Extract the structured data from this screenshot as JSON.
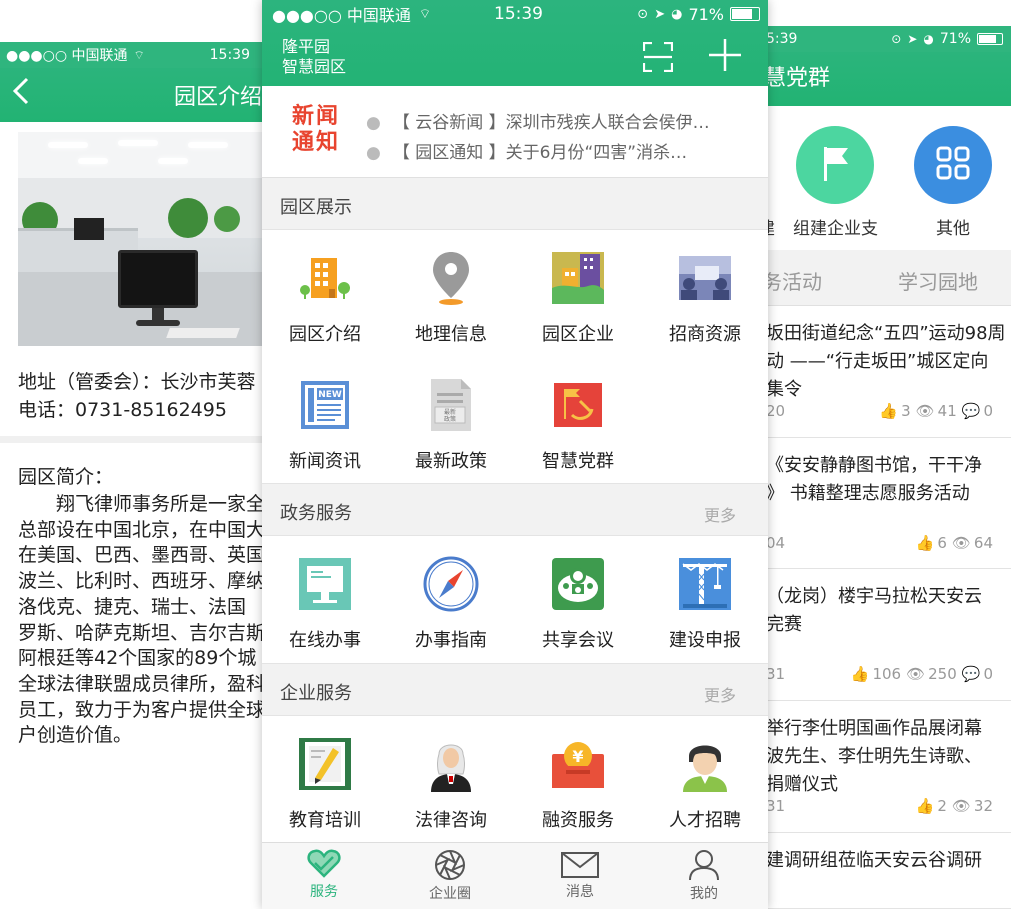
{
  "left": {
    "status": {
      "carrier": "●●●○○ 中国联通",
      "time": "15:39"
    },
    "title": "园区介绍",
    "address": "地址（管委会）：长沙市芙蓉",
    "phone": "电话：0731-85162495",
    "intro_title": "园区简介：",
    "intro_lines": [
      "　　翔飞律师事务所是一家全",
      "总部设在中国北京，在中国大",
      "在美国、巴西、墨西哥、英国",
      "波兰、比利时、西班牙、摩纳",
      "洛伐克、捷克、瑞士、法国",
      "罗斯、哈萨克斯坦、吉尔吉斯",
      "阿根廷等42个国家的89个城",
      "全球法律联盟成员律所，盈科",
      "员工，致力于为客户提供全球",
      "户创造价值。"
    ]
  },
  "center": {
    "status": {
      "carrier": "●●●○○ 中国联通",
      "time": "15:39",
      "battery": "71%"
    },
    "park_name": [
      "隆平园",
      "智慧园区"
    ],
    "news_logo": [
      "新闻",
      "通知"
    ],
    "news": [
      {
        "text": "【 云谷新闻 】深圳市残疾人联合会侯伊…"
      },
      {
        "text": "【 园区通知 】关于6月份“四害”消杀…"
      }
    ],
    "sections": [
      {
        "title": "园区展示",
        "more": "",
        "items": [
          {
            "label": "园区介绍",
            "icon": "building-icon"
          },
          {
            "label": "地理信息",
            "icon": "location-pin-icon"
          },
          {
            "label": "园区企业",
            "icon": "city-icon"
          },
          {
            "label": "招商资源",
            "icon": "office-icon"
          },
          {
            "label": "新闻资讯",
            "icon": "newspaper-icon"
          },
          {
            "label": "最新政策",
            "icon": "policy-doc-icon"
          },
          {
            "label": "智慧党群",
            "icon": "party-flag-icon"
          }
        ]
      },
      {
        "title": "政务服务",
        "more": "更多",
        "items": [
          {
            "label": "在线办事",
            "icon": "computer-icon"
          },
          {
            "label": "办事指南",
            "icon": "compass-icon"
          },
          {
            "label": "共享会议",
            "icon": "meeting-icon"
          },
          {
            "label": "建设申报",
            "icon": "crane-icon"
          }
        ]
      },
      {
        "title": "企业服务",
        "more": "更多",
        "items": [
          {
            "label": "教育培训",
            "icon": "pencil-board-icon"
          },
          {
            "label": "法律咨询",
            "icon": "judge-icon"
          },
          {
            "label": "融资服务",
            "icon": "money-wallet-icon"
          },
          {
            "label": "人才招聘",
            "icon": "person-icon"
          }
        ]
      }
    ],
    "tabbar": [
      {
        "label": "服务",
        "icon": "heart-icon",
        "active": true
      },
      {
        "label": "企业圈",
        "icon": "aperture-icon",
        "active": false
      },
      {
        "label": "消息",
        "icon": "mail-icon",
        "active": false
      },
      {
        "label": "我的",
        "icon": "user-icon",
        "active": false
      }
    ]
  },
  "right": {
    "status": {
      "time": "5:39",
      "battery": "71%"
    },
    "title": "慧党群",
    "circles": [
      {
        "label": "组建企业支",
        "color": "#4cd6a0",
        "icon": "flag-icon"
      },
      {
        "label": "其他",
        "color": "#3b8ee0",
        "icon": "grid-icon"
      }
    ],
    "partial_left_label": "建",
    "tabs": [
      "务活动",
      "学习园地"
    ],
    "news": [
      {
        "lines": [
          "坂田街道纪念“五四”运动98周",
          "动 ——“行走坂田”城区定向",
          "集令"
        ],
        "date": "20",
        "likes": "3",
        "views": "41",
        "comments": "0"
      },
      {
        "lines": [
          "《安安静静图书馆，干干净",
          "》 书籍整理志愿服务活动"
        ],
        "date": "04",
        "likes": "6",
        "views": "64",
        "comments": ""
      },
      {
        "lines": [
          "（龙岗）楼宇马拉松天安云",
          "完赛"
        ],
        "date": "31",
        "likes": "106",
        "views": "250",
        "comments": "0"
      },
      {
        "lines": [
          "举行李仕明国画作品展闭幕",
          "波先生、李仕明先生诗歌、",
          "捐赠仪式"
        ],
        "date": "31",
        "likes": "2",
        "views": "32",
        "comments": ""
      },
      {
        "lines": [
          "建调研组莅临天安云谷调研"
        ],
        "date": "",
        "likes": "",
        "views": "",
        "comments": ""
      }
    ]
  }
}
